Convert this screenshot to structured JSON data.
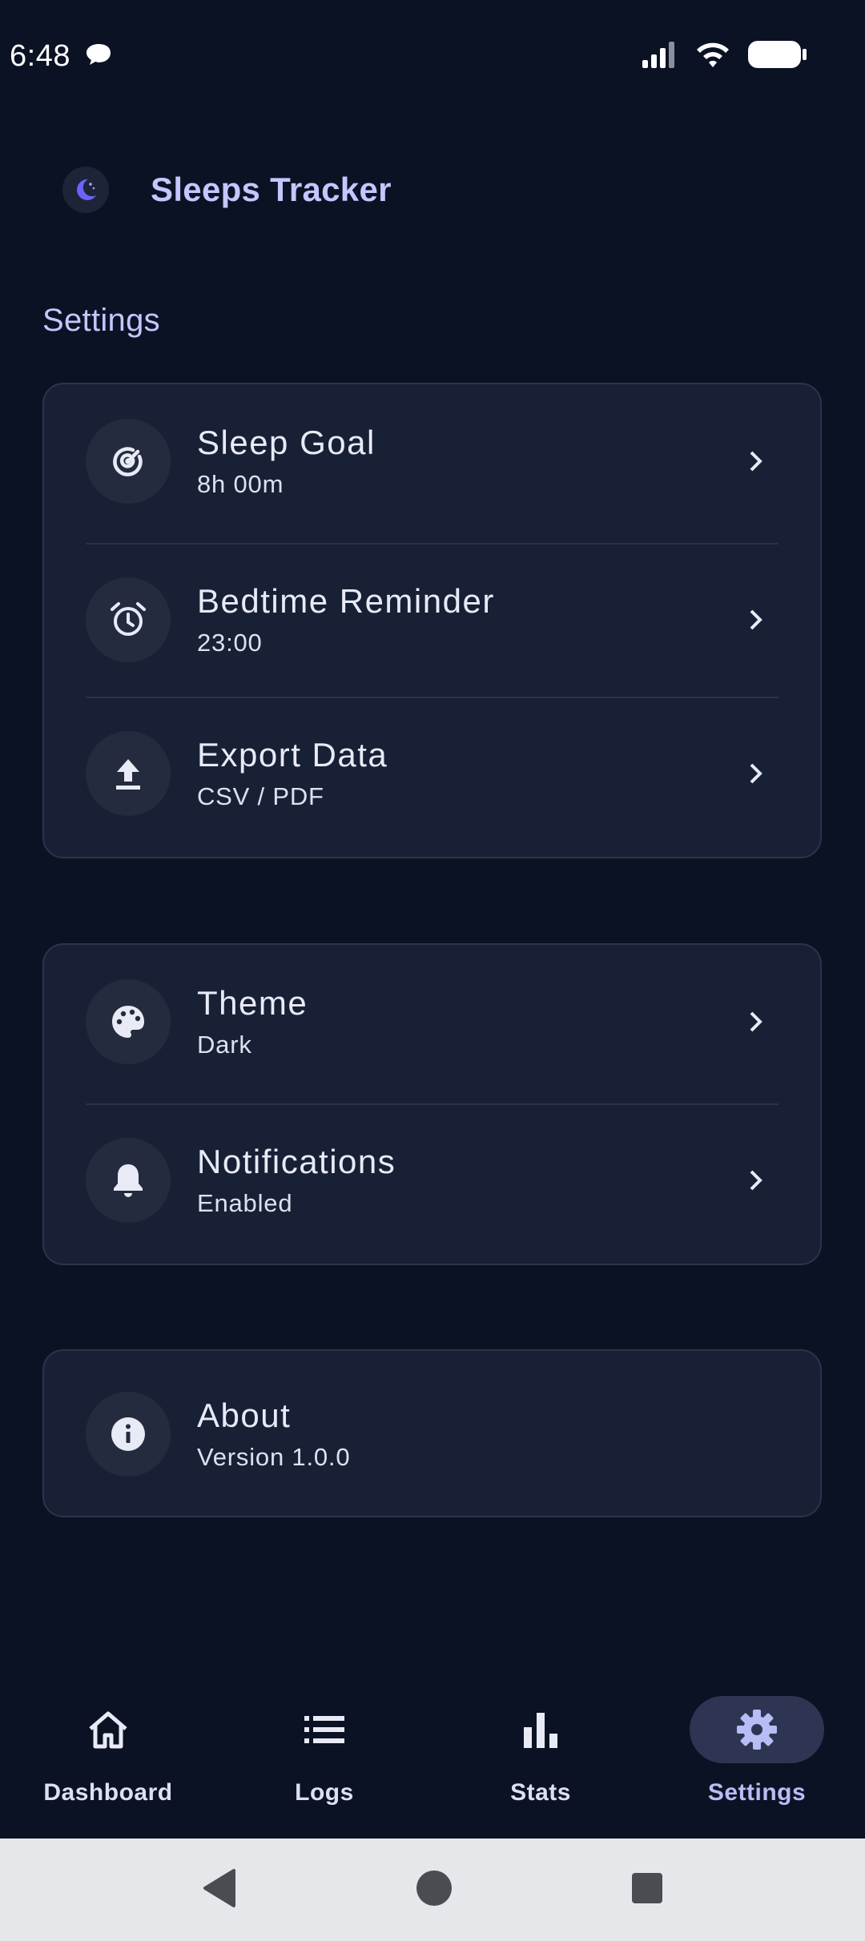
{
  "status_bar": {
    "time": "6:48"
  },
  "app": {
    "title": "Sleeps Tracker"
  },
  "page": {
    "section_title": "Settings"
  },
  "groups": [
    {
      "items": [
        {
          "icon": "target-icon",
          "title": "Sleep Goal",
          "subtitle": "8h 00m"
        },
        {
          "icon": "alarm-clock-icon",
          "title": "Bedtime Reminder",
          "subtitle": "23:00"
        },
        {
          "icon": "upload-icon",
          "title": "Export Data",
          "subtitle": "CSV / PDF"
        }
      ]
    },
    {
      "items": [
        {
          "icon": "palette-icon",
          "title": "Theme",
          "subtitle": "Dark"
        },
        {
          "icon": "bell-icon",
          "title": "Notifications",
          "subtitle": "Enabled"
        }
      ]
    },
    {
      "items": [
        {
          "icon": "info-icon",
          "title": "About",
          "subtitle": "Version 1.0.0"
        }
      ]
    }
  ],
  "bottom_nav": [
    {
      "icon": "home-icon",
      "label": "Dashboard",
      "active": false
    },
    {
      "icon": "list-icon",
      "label": "Logs",
      "active": false
    },
    {
      "icon": "bar-chart-icon",
      "label": "Stats",
      "active": false
    },
    {
      "icon": "gear-icon",
      "label": "Settings",
      "active": true
    }
  ],
  "colors": {
    "background": "#0b1224",
    "card": "#182035",
    "accent": "#c3c7ff",
    "active_pill": "#2e3552"
  }
}
